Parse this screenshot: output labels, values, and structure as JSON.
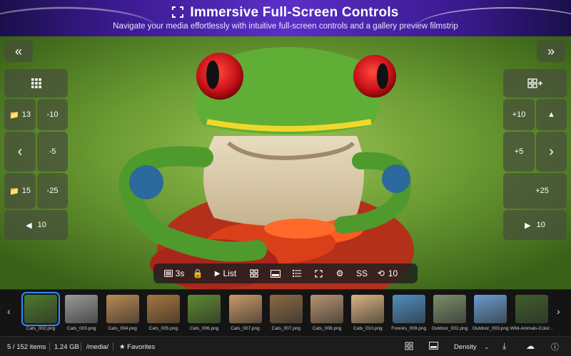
{
  "banner": {
    "title": "Immersive Full-Screen Controls",
    "subtitle": "Navigate your media effortlessly with intuitive full-screen controls and a gallery preview filmstrip"
  },
  "left_panel": {
    "prev": "«",
    "grid": "grid-icon",
    "row1": {
      "folder": "13",
      "step": "-10"
    },
    "row2": {
      "arrow": "‹",
      "step": "-5"
    },
    "row3": {
      "folder": "15",
      "step": "-25"
    },
    "row4": {
      "play": "◀",
      "count": "10"
    }
  },
  "right_panel": {
    "next": "»",
    "add_grid": "grid-plus-icon",
    "row1": {
      "step": "+10",
      "arrow": "▲"
    },
    "row2": {
      "step": "+5",
      "arrow": "›"
    },
    "row3": {
      "step": "+25"
    },
    "row4": {
      "play": "▶",
      "count": "10"
    }
  },
  "toolbar": {
    "interval": "3s",
    "list_label": "List",
    "ss_label": "SS",
    "repeat_count": "10"
  },
  "filmstrip": {
    "items": [
      {
        "label": "Cats_002.png",
        "selected": true,
        "color": "#4c7a2a"
      },
      {
        "label": "Cats_003.png",
        "color": "#9a9a9a"
      },
      {
        "label": "Cats_004.png",
        "color": "#b98a52"
      },
      {
        "label": "Cats_005.png",
        "color": "#a8763d"
      },
      {
        "label": "Cats_006.png",
        "color": "#5d8a2f"
      },
      {
        "label": "Cats_007.png",
        "color": "#c99a68"
      },
      {
        "label": "Cats_007.png",
        "color": "#8a6a45"
      },
      {
        "label": "Cats_008.png",
        "color": "#b8936e"
      },
      {
        "label": "Cats_010.png",
        "color": "#d9b380"
      },
      {
        "label": "Forests_009.png",
        "color": "#4f8fbf"
      },
      {
        "label": "Outdoor_002.png",
        "color": "#7a8f6a"
      },
      {
        "label": "Outdoor_003.png",
        "color": "#6b9ccf"
      },
      {
        "label": "Wild-Animals-Color…",
        "color": "#3f5f2a"
      }
    ]
  },
  "status": {
    "items": "5 / 152 items",
    "size": "1.24 GB",
    "path": "/media/",
    "favorites": "Favorites",
    "density": "Density"
  }
}
